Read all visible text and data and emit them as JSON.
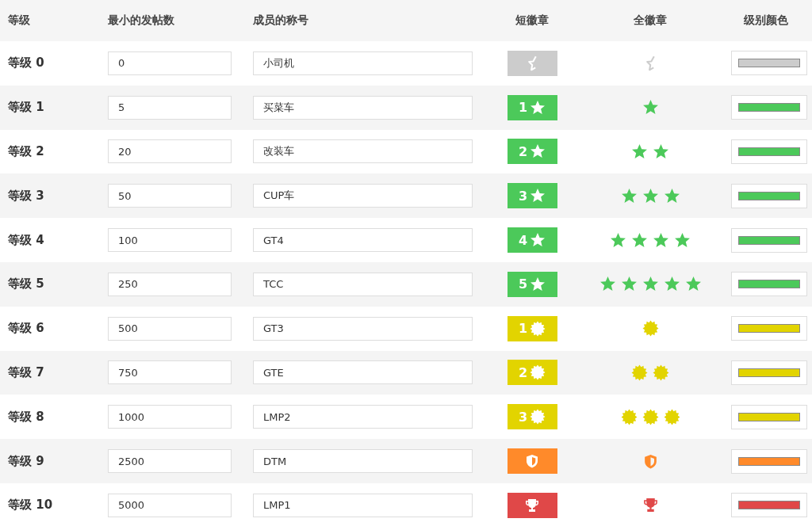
{
  "columns": [
    "等级",
    "最小的发帖数",
    "成员的称号",
    "短徽章",
    "全徽章",
    "级别颜色"
  ],
  "rows": [
    {
      "level_label": "等级 0",
      "min_posts": "0",
      "title": "小司机",
      "kind": "half-star",
      "full_badge": [
        {
          "kind": "half-star"
        }
      ],
      "color": "#cccccc"
    },
    {
      "level_label": "等级 1",
      "min_posts": "5",
      "title": "买菜车",
      "badge_number": "1",
      "kind": "star",
      "full_badge": [
        {
          "kind": "star"
        }
      ],
      "color": "#4cc95a"
    },
    {
      "level_label": "等级 2",
      "min_posts": "20",
      "title": "改装车",
      "badge_number": "2",
      "kind": "star",
      "full_badge": [
        {
          "kind": "star"
        },
        {
          "kind": "star"
        }
      ],
      "color": "#4cc95a"
    },
    {
      "level_label": "等级 3",
      "min_posts": "50",
      "title": "CUP车",
      "badge_number": "3",
      "kind": "star",
      "full_badge": [
        {
          "kind": "star"
        },
        {
          "kind": "star"
        },
        {
          "kind": "star"
        }
      ],
      "color": "#4cc95a"
    },
    {
      "level_label": "等级 4",
      "min_posts": "100",
      "title": "GT4",
      "badge_number": "4",
      "kind": "star",
      "full_badge": [
        {
          "kind": "star"
        },
        {
          "kind": "star"
        },
        {
          "kind": "star"
        },
        {
          "kind": "star"
        }
      ],
      "color": "#4cc95a"
    },
    {
      "level_label": "等级 5",
      "min_posts": "250",
      "title": "TCC",
      "badge_number": "5",
      "kind": "star",
      "full_badge": [
        {
          "kind": "star"
        },
        {
          "kind": "star"
        },
        {
          "kind": "star"
        },
        {
          "kind": "star"
        },
        {
          "kind": "star"
        }
      ],
      "color": "#4cc95a"
    },
    {
      "level_label": "等级 6",
      "min_posts": "500",
      "title": "GT3",
      "badge_number": "1",
      "kind": "sunburst",
      "full_badge": [
        {
          "kind": "sunburst"
        }
      ],
      "color": "#e2d400"
    },
    {
      "level_label": "等级 7",
      "min_posts": "750",
      "title": "GTE",
      "badge_number": "2",
      "kind": "sunburst",
      "full_badge": [
        {
          "kind": "sunburst"
        },
        {
          "kind": "sunburst"
        }
      ],
      "color": "#e2d400"
    },
    {
      "level_label": "等级 8",
      "min_posts": "1000",
      "title": "LMP2",
      "badge_number": "3",
      "kind": "sunburst",
      "full_badge": [
        {
          "kind": "sunburst"
        },
        {
          "kind": "sunburst"
        },
        {
          "kind": "sunburst"
        }
      ],
      "color": "#e2d400"
    },
    {
      "level_label": "等级 9",
      "min_posts": "2500",
      "title": "DTM",
      "kind": "shield",
      "full_badge": [
        {
          "kind": "shield"
        }
      ],
      "color": "#ff8a2a"
    },
    {
      "level_label": "等级 10",
      "min_posts": "5000",
      "title": "LMP1",
      "kind": "trophy",
      "full_badge": [
        {
          "kind": "trophy"
        }
      ],
      "color": "#e04848"
    }
  ]
}
